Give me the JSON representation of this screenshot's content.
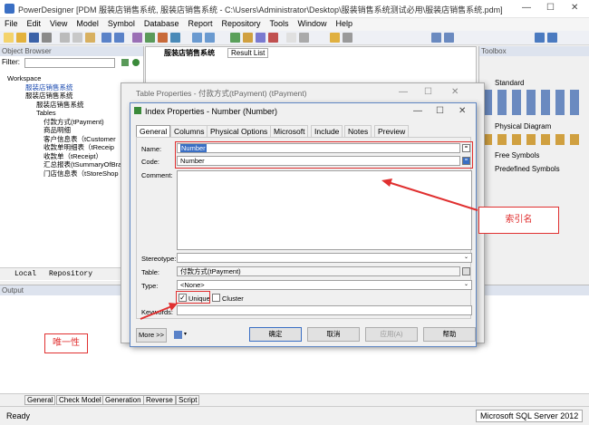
{
  "app": {
    "title": "PowerDesigner [PDM 服装店销售系统, 服装店销售系统 - C:\\Users\\Administrator\\Desktop\\服装销售系统测试必用\\服装店销售系统.pdm]"
  },
  "menu": [
    "File",
    "Edit",
    "View",
    "Model",
    "Symbol",
    "Database",
    "Report",
    "Repository",
    "Tools",
    "Window",
    "Help"
  ],
  "object_browser": {
    "title": "Object Browser",
    "filter_label": "Filter:",
    "tree": [
      "Workspace",
      "服装店销售系统",
      "服装店销售系统",
      "服装店销售系统",
      "Tables",
      "付款方式(tPayment)",
      "商品明细",
      "客户信息表（tCustomer",
      "收款单明细表（tReceip",
      "收款单（tReceipt）",
      "汇总报表(tSummaryOfBra",
      "门店信息表（tStoreShop"
    ],
    "tab_local": "Local",
    "tab_repository": "Repository"
  },
  "doc_tabs": [
    "服装店销售系统",
    "Result List"
  ],
  "toolbox": {
    "title": "Toolbox",
    "sections": [
      "Standard",
      "Physical Diagram",
      "Free Symbols",
      "Predefined Symbols"
    ]
  },
  "output": {
    "title": "Output",
    "tabs": [
      "General",
      "Check Model",
      "Generation",
      "Reverse",
      "Script"
    ]
  },
  "status": {
    "left": "Ready",
    "right": "Microsoft SQL Server 2012"
  },
  "table_props": {
    "title": "Table Properties - 付款方式(tPayment) (tPayment)"
  },
  "index_props": {
    "title": "Index Properties - Number (Number)",
    "tabs": [
      "General",
      "Columns",
      "Physical Options",
      "Microsoft",
      "Include",
      "Notes",
      "Preview"
    ],
    "name_label": "Name:",
    "name_value": "Number",
    "code_label": "Code:",
    "code_value": "Number",
    "comment_label": "Comment:",
    "stereotype_label": "Stereotype:",
    "table_label": "Table:",
    "table_value": "付款方式(tPayment)",
    "type_label": "Type:",
    "type_value": "<None>",
    "unique_label": "Unique",
    "cluster_label": "Cluster",
    "keywords_label": "Keywords:",
    "more_label": "More >>",
    "buttons": [
      "确定",
      "取消",
      "应用(A)",
      "帮助"
    ]
  },
  "annotations": {
    "index_name": "索引名",
    "unique": "唯一性"
  }
}
